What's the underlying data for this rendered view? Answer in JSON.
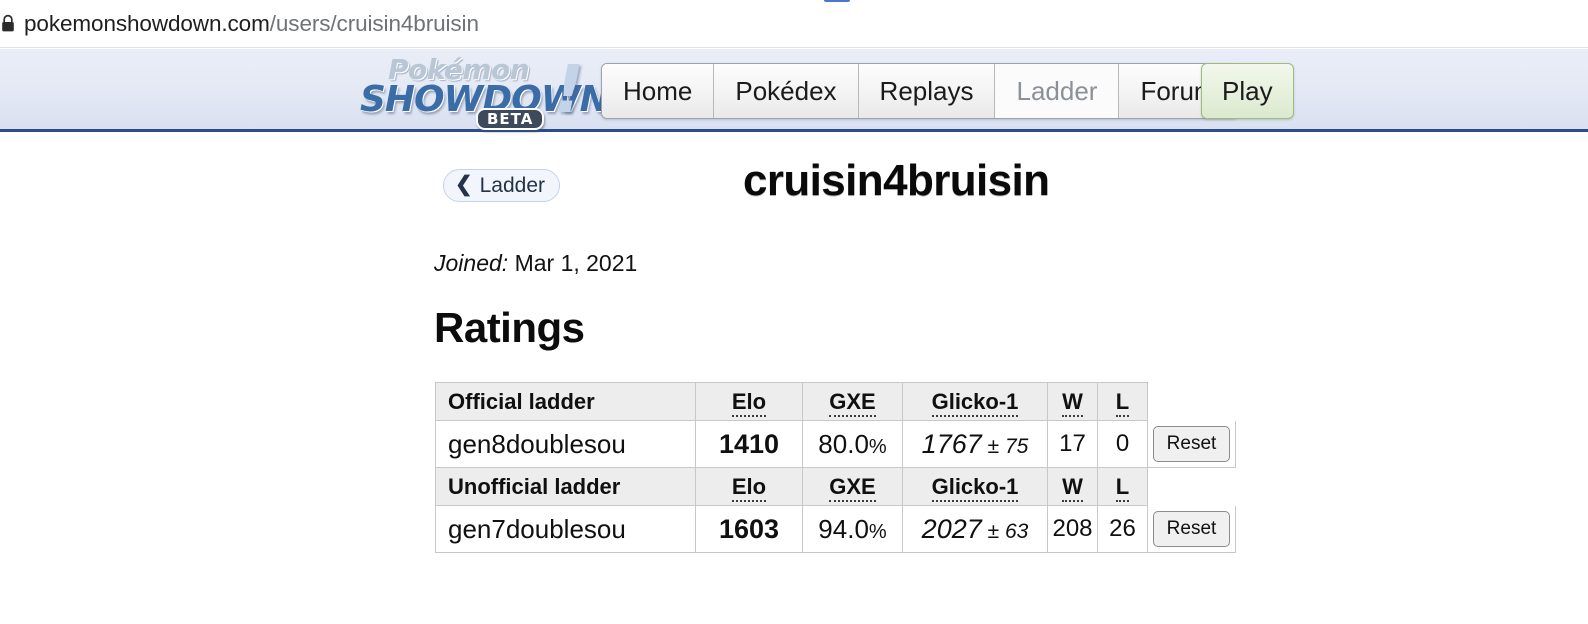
{
  "browser": {
    "lock_icon": "lock-icon",
    "url_host": "pokemonshowdown.com",
    "url_path": "/users/cruisin4bruisin"
  },
  "site_header": {
    "logo": {
      "line1": "Pokémon",
      "line2": "SHOWDOWN",
      "badge": "BETA",
      "bang": "!"
    },
    "nav": [
      {
        "label": "Home",
        "current": false
      },
      {
        "label": "Pokédex",
        "current": false
      },
      {
        "label": "Replays",
        "current": false
      },
      {
        "label": "Ladder",
        "current": true
      },
      {
        "label": "Forum",
        "current": false
      }
    ],
    "play_label": "Play"
  },
  "page": {
    "back_label": "Ladder",
    "back_icon": "chevron-left-icon",
    "username": "cruisin4bruisin",
    "joined_label": "Joined:",
    "joined_value": "Mar 1, 2021",
    "ratings_heading": "Ratings"
  },
  "ratings": {
    "columns": {
      "elo": "Elo",
      "gxe": "GXE",
      "glicko": "Glicko-1",
      "w": "W",
      "l": "L"
    },
    "reset_label": "Reset",
    "sections": [
      {
        "title": "Official ladder",
        "rows": [
          {
            "format": "gen8doublesou",
            "elo": "1410",
            "gxe_value": "80.0",
            "gxe_pct": "%",
            "glicko_rating": "1767",
            "glicko_sep": " ± ",
            "glicko_dev": "75",
            "w": "17",
            "l": "0"
          }
        ]
      },
      {
        "title": "Unofficial ladder",
        "rows": [
          {
            "format": "gen7doublesou",
            "elo": "1603",
            "gxe_value": "94.0",
            "gxe_pct": "%",
            "glicko_rating": "2027",
            "glicko_sep": " ± ",
            "glicko_dev": "63",
            "w": "208",
            "l": "26"
          }
        ]
      }
    ]
  },
  "colors": {
    "header_gradient_top": "#e9edf7",
    "header_border": "#2a4d8f",
    "logo_blue": "#3a6ca8",
    "play_green_border": "#9cbb7e",
    "table_header_bg": "#ededed"
  }
}
